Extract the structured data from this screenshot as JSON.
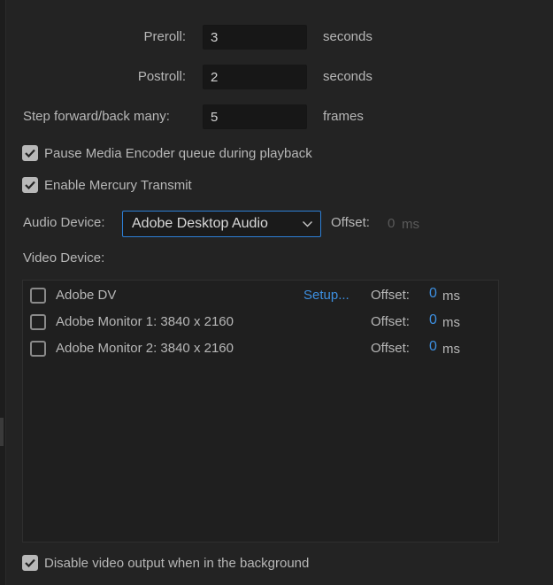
{
  "playback": {
    "preroll_label": "Preroll:",
    "preroll_value": "3",
    "preroll_unit": "seconds",
    "postroll_label": "Postroll:",
    "postroll_value": "2",
    "postroll_unit": "seconds",
    "step_label": "Step forward/back many:",
    "step_value": "5",
    "step_unit": "frames"
  },
  "options": {
    "pause_encoder_label": "Pause Media Encoder queue during playback",
    "pause_encoder_checked": true,
    "mercury_label": "Enable Mercury Transmit",
    "mercury_checked": true,
    "disable_bg_label": "Disable video output when in the background",
    "disable_bg_checked": true
  },
  "audio": {
    "label": "Audio Device:",
    "selected": "Adobe Desktop Audio",
    "offset_label": "Offset:",
    "offset_value": "0",
    "offset_unit": "ms"
  },
  "video": {
    "label": "Video Device:",
    "devices": [
      {
        "name": "Adobe DV",
        "checked": false,
        "setup_label": "Setup...",
        "offset_label": "Offset:",
        "offset_value": "0",
        "offset_unit": "ms"
      },
      {
        "name": "Adobe Monitor 1: 3840 x 2160",
        "checked": false,
        "offset_label": "Offset:",
        "offset_value": "0",
        "offset_unit": "ms"
      },
      {
        "name": "Adobe Monitor 2: 3840 x 2160",
        "checked": false,
        "offset_label": "Offset:",
        "offset_value": "0",
        "offset_unit": "ms"
      }
    ]
  },
  "colors": {
    "background": "#232323",
    "accent": "#3d8fe0",
    "focus_border": "#2d7fd6",
    "text": "#b7b7b7"
  },
  "icons": {
    "checkmark": "checkmark-icon",
    "dropdown": "chevron-down-icon"
  }
}
